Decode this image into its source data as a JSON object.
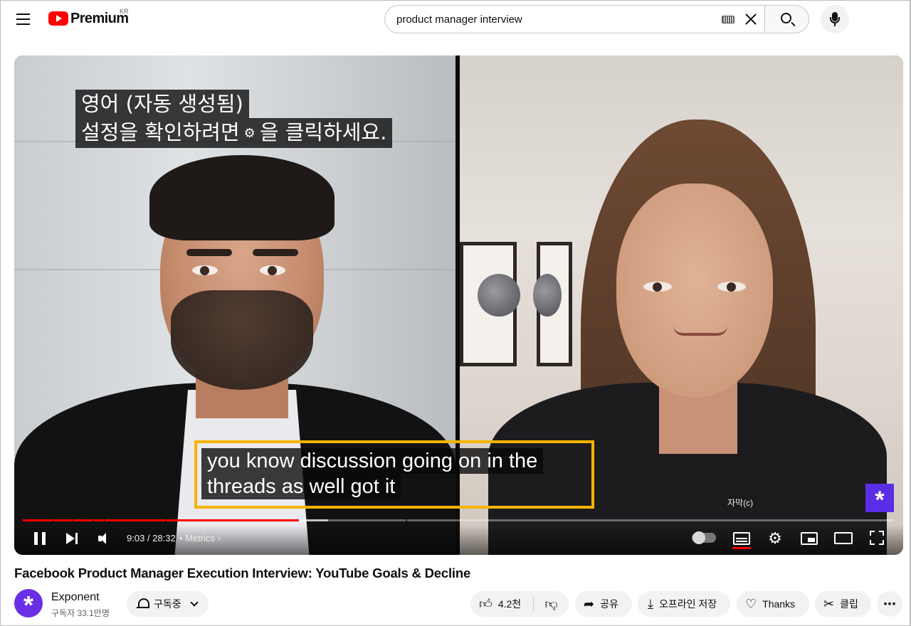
{
  "header": {
    "logo_text": "Premium",
    "logo_region": "KR",
    "search": {
      "value": "product manager interview"
    }
  },
  "player": {
    "caption_notice": {
      "line1": "영어 (자동 생성됨)",
      "line2_before": "설정을 확인하려면",
      "line2_after": "을 클릭하세요."
    },
    "subtitle": {
      "line1": "you know discussion going on in the",
      "line2": "threads as well got it"
    },
    "tooltip": "자막(c)",
    "time": "9:03 / 28:32",
    "chapter": "• Metrics ›",
    "progress": {
      "played_fraction": 0.317,
      "buffered_fraction": 0.35
    }
  },
  "video": {
    "title": "Facebook Product Manager Execution Interview: YouTube Goals & Decline",
    "channel": {
      "name": "Exponent",
      "subscribers": "구독자 33.1만명"
    },
    "subscribe_label": "구독중",
    "likes": "4.2천",
    "share_label": "공유",
    "offline_label": "오프라인 저장",
    "thanks_label": "Thanks",
    "clip_label": "클립"
  },
  "colors": {
    "accent": "#ff0000",
    "highlight": "#f5b400",
    "brand": "#5a2ee6"
  }
}
